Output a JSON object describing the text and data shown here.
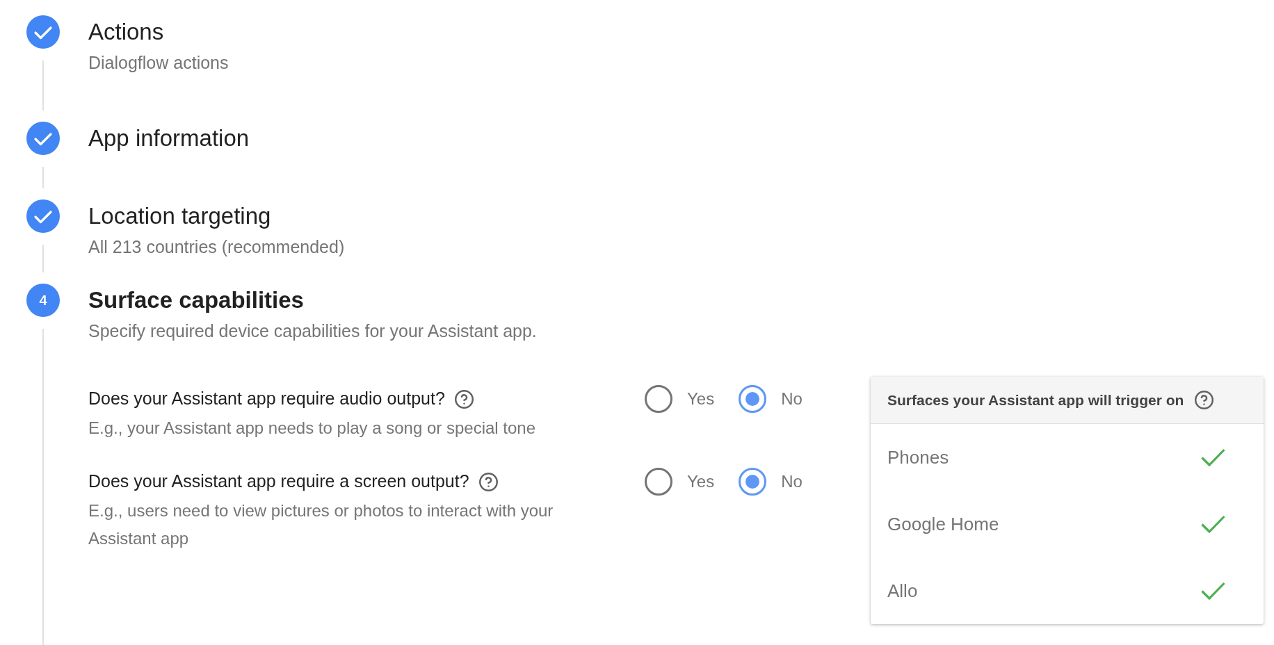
{
  "steps": [
    {
      "kind": "completed",
      "title": "Actions",
      "subtitle": "Dialogflow actions"
    },
    {
      "kind": "completed",
      "title": "App information"
    },
    {
      "kind": "completed",
      "title": "Location targeting",
      "subtitle": "All 213 countries (recommended)"
    },
    {
      "kind": "current",
      "number": "4",
      "title": "Surface capabilities",
      "subtitle": "Specify required device capabilities for your Assistant app.",
      "questions": [
        {
          "question": "Does your Assistant app require audio output?",
          "hint": "E.g., your Assistant app needs to play a song or special tone",
          "options": [
            {
              "label": "Yes",
              "selected": false
            },
            {
              "label": "No",
              "selected": true
            }
          ]
        },
        {
          "question": "Does your Assistant app require a screen output?",
          "hint": "E.g., users need to view pictures or photos to interact with your Assistant app",
          "options": [
            {
              "label": "Yes",
              "selected": false
            },
            {
              "label": "No",
              "selected": true
            }
          ]
        }
      ],
      "surfaces_panel": {
        "title": "Surfaces your Assistant app will trigger on",
        "surfaces": [
          {
            "name": "Phones",
            "enabled": true
          },
          {
            "name": "Google Home",
            "enabled": true
          },
          {
            "name": "Allo",
            "enabled": true
          }
        ]
      }
    }
  ]
}
